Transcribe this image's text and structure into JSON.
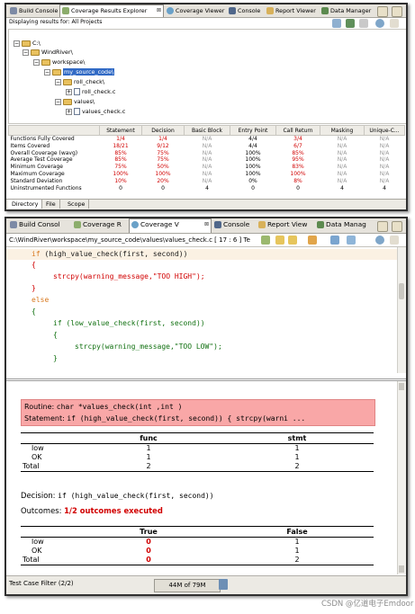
{
  "top_panel": {
    "tabs": [
      {
        "label": "Build Console",
        "active": false
      },
      {
        "label": "Coverage Results Explorer",
        "active": true
      },
      {
        "label": "Coverage Viewer",
        "active": false
      },
      {
        "label": "Console",
        "active": false
      },
      {
        "label": "Report Viewer",
        "active": false
      },
      {
        "label": "Data Manager",
        "active": false
      }
    ],
    "close_glyph": "⊠",
    "results_header": "Displaying results for: All Projects",
    "tree": {
      "root": "C:\\",
      "windriver": "WindRiver\\",
      "workspace": "workspace\\",
      "my_source_code": "my_source_code\\",
      "roll_check_dir": "roll_check\\",
      "roll_check_file": "roll_check.c",
      "values_dir": "values\\",
      "values_check_file": "values_check.c"
    },
    "table": {
      "columns": [
        "",
        "Statement",
        "Decision",
        "Basic Block",
        "Entry Point",
        "Call Return",
        "Masking",
        "Unique-C..."
      ],
      "rows": [
        {
          "label": "Functions Fully Covered",
          "cells": [
            "1/4",
            "1/4",
            "N/A",
            "4/4",
            "3/4",
            "N/A",
            "N/A"
          ]
        },
        {
          "label": "Items Covered",
          "cells": [
            "18/21",
            "9/12",
            "N/A",
            "4/4",
            "6/7",
            "N/A",
            "N/A"
          ]
        },
        {
          "label": "Overall Coverage (wavg)",
          "cells": [
            "85%",
            "75%",
            "N/A",
            "100%",
            "85%",
            "N/A",
            "N/A"
          ]
        },
        {
          "label": "Average Test Coverage",
          "cells": [
            "85%",
            "75%",
            "N/A",
            "100%",
            "95%",
            "N/A",
            "N/A"
          ]
        },
        {
          "label": "Minimum Coverage",
          "cells": [
            "75%",
            "50%",
            "N/A",
            "100%",
            "83%",
            "N/A",
            "N/A"
          ]
        },
        {
          "label": "Maximum Coverage",
          "cells": [
            "100%",
            "100%",
            "N/A",
            "100%",
            "100%",
            "N/A",
            "N/A"
          ]
        },
        {
          "label": "Standard Deviation",
          "cells": [
            "10%",
            "20%",
            "N/A",
            "0%",
            "8%",
            "N/A",
            "N/A"
          ]
        },
        {
          "label": "Uninstrumented Functions",
          "cells": [
            "0",
            "0",
            "4",
            "0",
            "0",
            "4",
            "4"
          ]
        }
      ]
    },
    "bottom_tabs": [
      "Directory",
      "File",
      "Scope"
    ]
  },
  "bottom_panel": {
    "tabs": [
      {
        "label": "Build Consol",
        "active": false
      },
      {
        "label": "Coverage R",
        "active": false
      },
      {
        "label": "Coverage V",
        "active": true
      },
      {
        "label": "Console",
        "active": false
      },
      {
        "label": "Report View",
        "active": false
      },
      {
        "label": "Data Manag",
        "active": false
      }
    ],
    "path": "C:\\WindRiver\\workspace\\my_source_code\\values\\values_check.c",
    "cursor_position": "[ 17 : 6 ]",
    "path_suffix": "Te",
    "code_lines": [
      "if (high_value_check(first, second))",
      "{",
      "strcpy(warning_message,\"TOO HIGH\");",
      "}",
      "else",
      "{",
      "if (low_value_check(first, second))",
      "{",
      "strcpy(warning_message,\"TOO LOW\");",
      "}"
    ],
    "routine_label": "Routine:",
    "routine_value": "char *values_check(int ,int )",
    "statement_label": "Statement:",
    "statement_value": "if (high_value_check(first, second)) { strcpy(warni ...",
    "routine_table": {
      "columns": [
        "",
        "func",
        "stmt"
      ],
      "rows": [
        {
          "label": "low",
          "func": "1",
          "stmt": "1"
        },
        {
          "label": "OK",
          "func": "1",
          "stmt": "1"
        },
        {
          "label": "Total",
          "func": "2",
          "stmt": "2"
        }
      ]
    },
    "decision_label": "Decision:",
    "decision_value": "if (high_value_check(first, second))",
    "outcomes_label": "Outcomes:",
    "outcomes_value": "1/2 outcomes executed",
    "outcome_table": {
      "columns": [
        "",
        "True",
        "False"
      ],
      "rows": [
        {
          "label": "low",
          "true": "0",
          "false": "1"
        },
        {
          "label": "OK",
          "true": "0",
          "false": "1"
        },
        {
          "label": "Total",
          "true": "0",
          "false": "2"
        }
      ]
    },
    "status": {
      "filter": "Test Case Filter (2/2)",
      "memory": "44M of 79M"
    }
  },
  "watermark": "CSDN @亿道电子Emdoor",
  "colors": {
    "accent_red": "#d10000",
    "routine_bg": "#f9a7a7",
    "selection": "#316ac5",
    "folder": "#e9c15e"
  }
}
